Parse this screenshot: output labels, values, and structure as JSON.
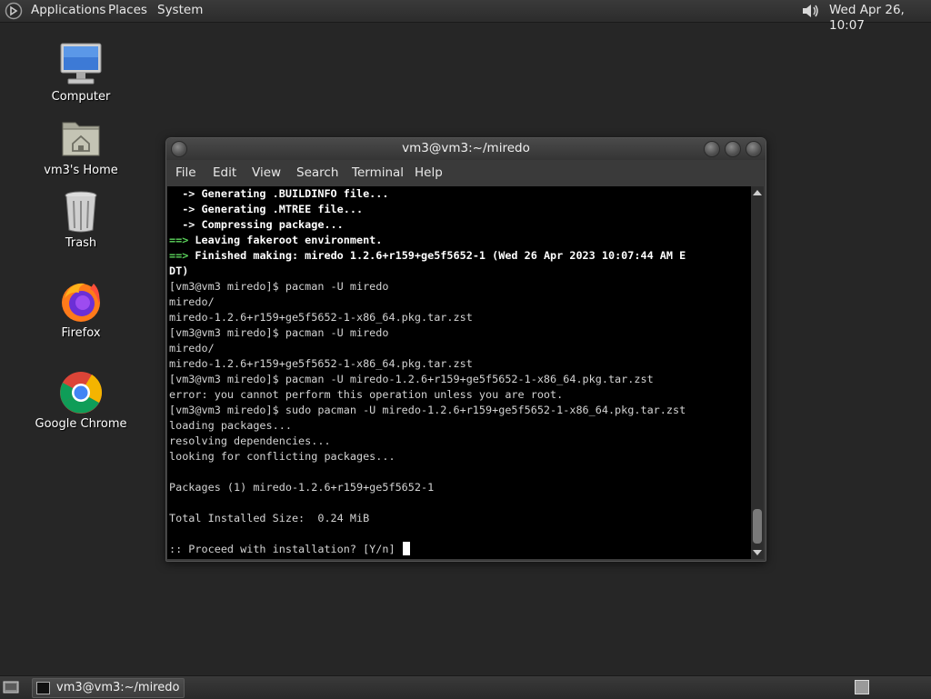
{
  "top_panel": {
    "menus": [
      "Applications",
      "Places",
      "System"
    ],
    "clock": "Wed Apr 26, 10:07",
    "icons": {
      "logo": "gnome-foot-icon",
      "volume": "speaker-icon"
    }
  },
  "desktop": {
    "icons": [
      {
        "label": "Computer",
        "icon": "monitor-icon"
      },
      {
        "label": "vm3's Home",
        "icon": "home-folder-icon"
      },
      {
        "label": "Trash",
        "icon": "trash-icon"
      },
      {
        "label": "Firefox",
        "icon": "firefox-icon"
      },
      {
        "label": "Google Chrome",
        "icon": "chrome-icon"
      }
    ]
  },
  "terminal": {
    "title": "vm3@vm3:~/miredo",
    "menu": [
      "File",
      "Edit",
      "View",
      "Search",
      "Terminal",
      "Help"
    ],
    "lines": [
      {
        "style": "b",
        "text": "  -> Generating .BUILDINFO file..."
      },
      {
        "style": "b",
        "text": "  -> Generating .MTREE file..."
      },
      {
        "style": "b",
        "text": "  -> Compressing package..."
      },
      {
        "style": "gb",
        "prefix": "==>",
        "text": " Leaving fakeroot environment."
      },
      {
        "style": "gb",
        "prefix": "==>",
        "text": " Finished making: miredo 1.2.6+r159+ge5f5652-1 (Wed 26 Apr 2023 10:07:44 AM E"
      },
      {
        "style": "b",
        "text": "DT)"
      },
      {
        "style": "n",
        "text": "[vm3@vm3 miredo]$ pacman -U miredo"
      },
      {
        "style": "n",
        "text": "miredo/"
      },
      {
        "style": "n",
        "text": "miredo-1.2.6+r159+ge5f5652-1-x86_64.pkg.tar.zst"
      },
      {
        "style": "n",
        "text": "[vm3@vm3 miredo]$ pacman -U miredo"
      },
      {
        "style": "n",
        "text": "miredo/"
      },
      {
        "style": "n",
        "text": "miredo-1.2.6+r159+ge5f5652-1-x86_64.pkg.tar.zst"
      },
      {
        "style": "n",
        "text": "[vm3@vm3 miredo]$ pacman -U miredo-1.2.6+r159+ge5f5652-1-x86_64.pkg.tar.zst"
      },
      {
        "style": "n",
        "text": "error: you cannot perform this operation unless you are root."
      },
      {
        "style": "n",
        "text": "[vm3@vm3 miredo]$ sudo pacman -U miredo-1.2.6+r159+ge5f5652-1-x86_64.pkg.tar.zst"
      },
      {
        "style": "n",
        "text": "loading packages..."
      },
      {
        "style": "n",
        "text": "resolving dependencies..."
      },
      {
        "style": "n",
        "text": "looking for conflicting packages..."
      },
      {
        "style": "n",
        "text": ""
      },
      {
        "style": "n",
        "text": "Packages (1) miredo-1.2.6+r159+ge5f5652-1"
      },
      {
        "style": "n",
        "text": ""
      },
      {
        "style": "n",
        "text": "Total Installed Size:  0.24 MiB"
      },
      {
        "style": "n",
        "text": ""
      },
      {
        "style": "n",
        "text": ":: Proceed with installation? [Y/n] ",
        "cursor": true
      }
    ]
  },
  "bottom_panel": {
    "task_label": "vm3@vm3:~/miredo"
  }
}
